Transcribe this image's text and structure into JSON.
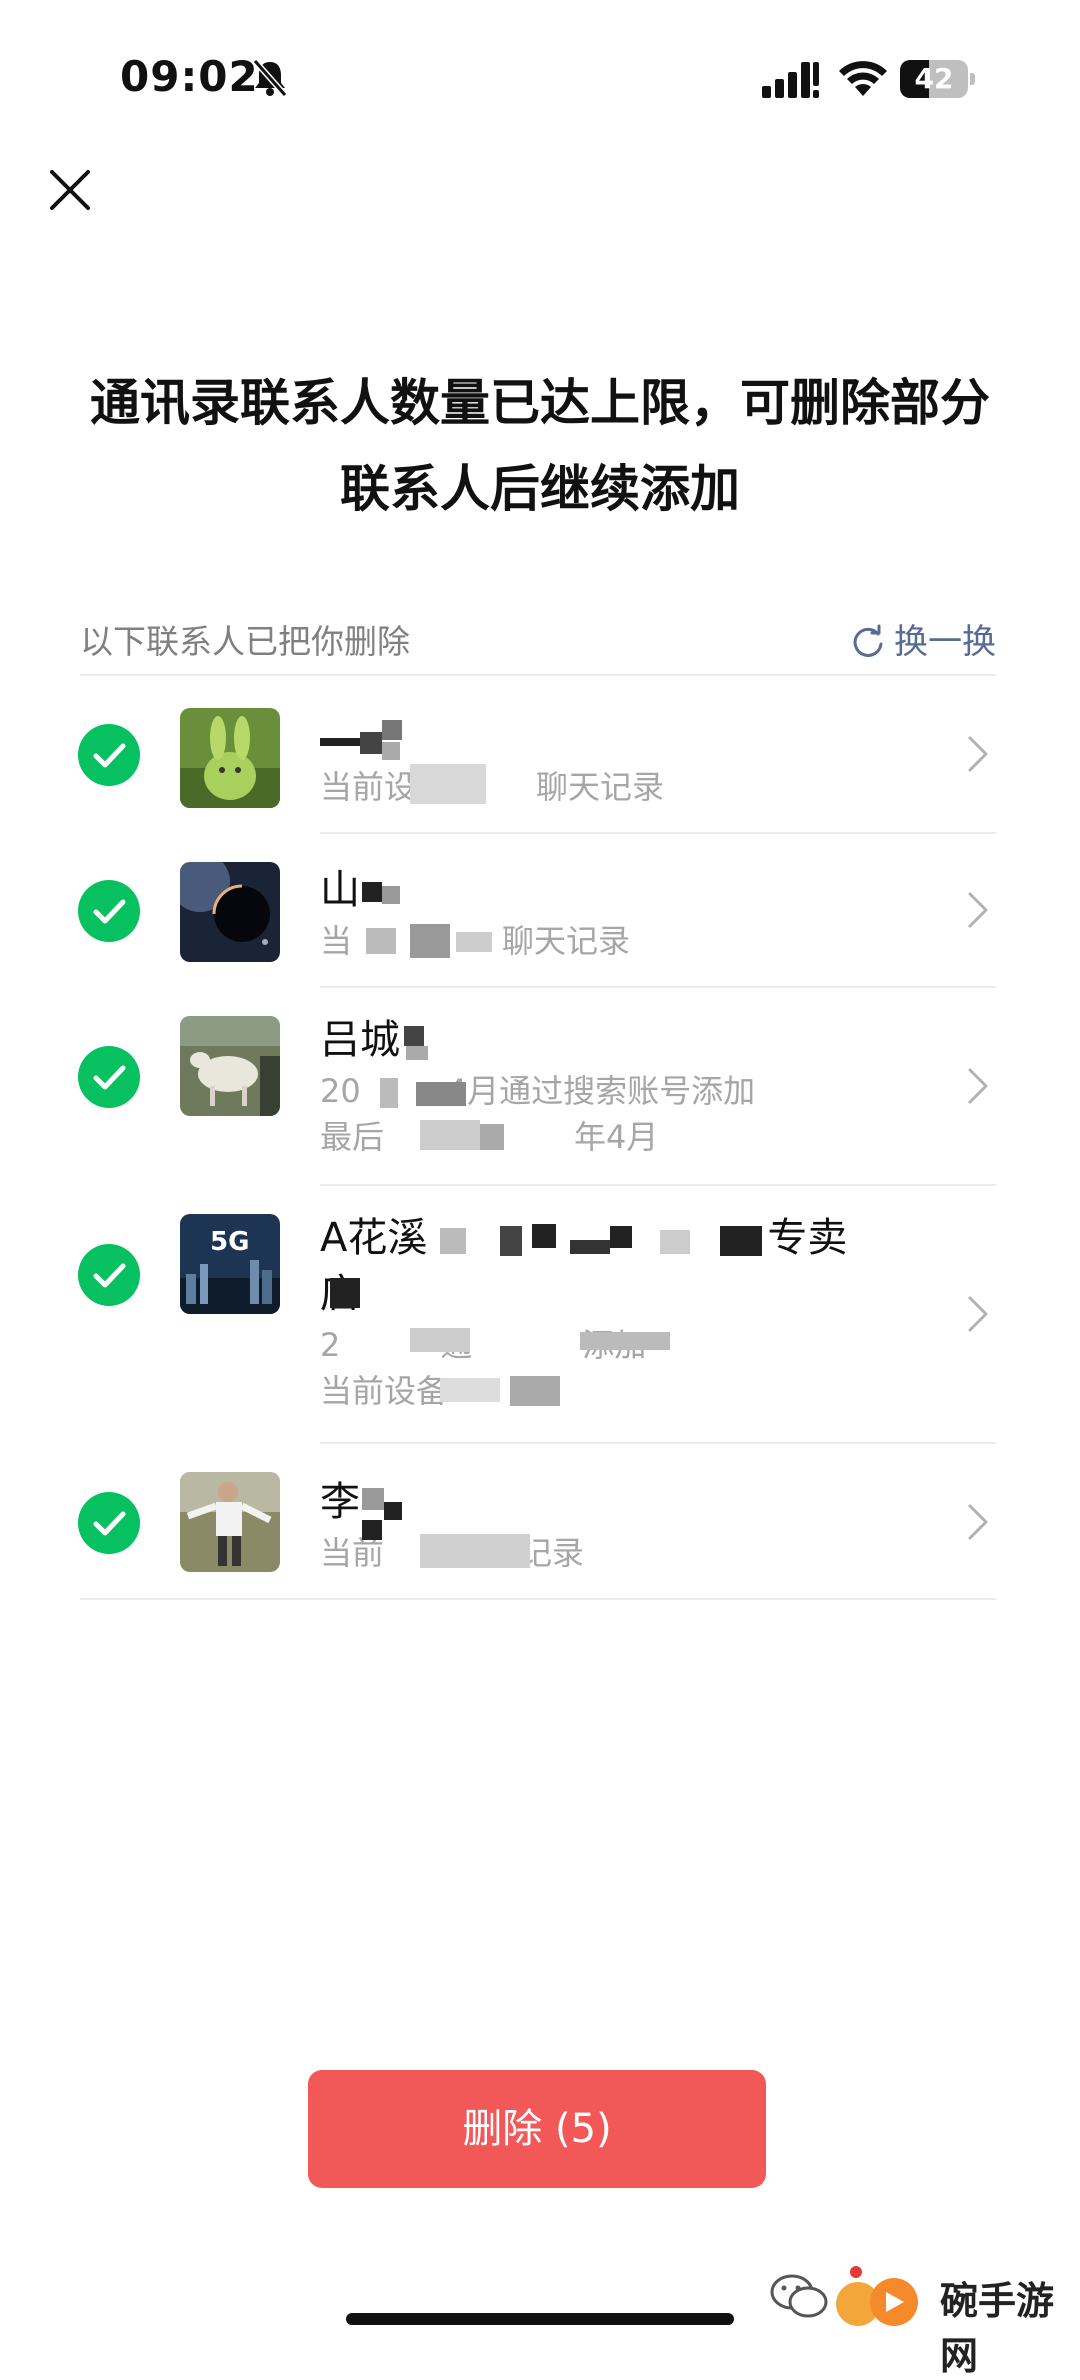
{
  "status_bar": {
    "time": "09:02",
    "battery": "42",
    "battery_level": 0.42
  },
  "title": "通讯录联系人数量已达上限，可删除部分联系人后继续添加",
  "section": {
    "label": "以下联系人已把你删除",
    "refresh_label": "换一换"
  },
  "contacts": [
    {
      "name": "",
      "lines": [
        "当前设",
        "聊天记录"
      ],
      "selected": true,
      "avatar": "green-rabbit-figurine"
    },
    {
      "name": "山",
      "lines": [
        "当",
        "聊天记录"
      ],
      "selected": true,
      "avatar": "planet-space"
    },
    {
      "name": "吕城",
      "lines": [
        "20",
        "4月通过搜索账号添加",
        "最后",
        "年4月"
      ],
      "selected": true,
      "avatar": "white-goat"
    },
    {
      "name": "A花溪",
      "name_end": "专卖",
      "name_line2": "店",
      "lines": [
        "2",
        "通",
        "添加",
        "当前设备"
      ],
      "selected": true,
      "avatar": "5g-city"
    },
    {
      "name": "李",
      "lines": [
        "当前",
        "记录"
      ],
      "selected": true,
      "avatar": "man-in-field"
    }
  ],
  "delete_button": {
    "label": "删除 (5)"
  },
  "watermark": {
    "text": "碗手游网"
  },
  "colors": {
    "accent_green": "#07c160",
    "delete_red": "#f25858",
    "link_blue": "#576b95"
  }
}
